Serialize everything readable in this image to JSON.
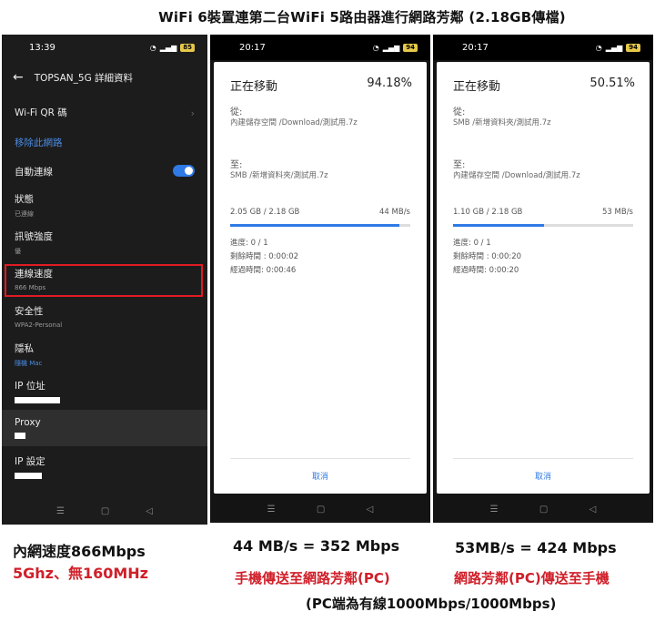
{
  "main_title": "WiFi 6裝置連第二台WiFi 5路由器進行網路芳鄰 (2.18GB傳檔)",
  "phone1": {
    "time": "13:39",
    "battery": "85",
    "header_title": "TOPSAN_5G 詳細資料",
    "rows": {
      "wifi_qr": "Wi-Fi QR 碼",
      "remove_network": "移除此網路",
      "auto_connect": "自動連線",
      "status_label": "狀態",
      "status_value": "已連線",
      "signal_label": "訊號強度",
      "signal_value": "優",
      "speed_label": "連線速度",
      "speed_value": "866 Mbps",
      "security_label": "安全性",
      "security_value": "WPA2-Personal",
      "privacy_label": "隱私",
      "privacy_value": "隨機 Mac",
      "ip_label": "IP 位址",
      "proxy_label": "Proxy",
      "ip_settings_label": "IP 設定"
    },
    "auto_connect_on": true
  },
  "phone2": {
    "time": "20:17",
    "battery": "94",
    "title": "正在移動",
    "percent": "94.18%",
    "from_label": "從:",
    "from_path": "內建儲存空間 /Download/測試用.7z",
    "to_label": "至:",
    "to_path": "SMB /新增資料夾/測試用.7z",
    "size_progress": "2.05 GB / 2.18 GB",
    "speed": "44 MB/s",
    "progress_fraction": 0.9418,
    "count": "進度: 0 / 1",
    "remaining": "剩餘時間 :  0:00:02",
    "elapsed": "經過時間: 0:00:46",
    "cancel": "取消"
  },
  "phone3": {
    "time": "20:17",
    "battery": "94",
    "title": "正在移動",
    "percent": "50.51%",
    "from_label": "從:",
    "from_path": "SMB /新增資料夾/測試用.7z",
    "to_label": "至:",
    "to_path": "內建儲存空間 /Download/測試用.7z",
    "size_progress": "1.10 GB / 2.18 GB",
    "speed": "53 MB/s",
    "progress_fraction": 0.5051,
    "count": "進度: 0 / 1",
    "remaining": "剩餘時間 :  0:00:20",
    "elapsed": "經過時間: 0:00:20",
    "cancel": "取消"
  },
  "captions": {
    "c1_line1": "內網速度866Mbps",
    "c1_line2": "5Ghz、無160MHz",
    "c2_line1": "44 MB/s =  352 Mbps",
    "c2_line2": "手機傳送至網路芳鄰(PC)",
    "c3_line1": "53MB/s = 424 Mbps",
    "c3_line2": "網路芳鄰(PC)傳送至手機",
    "c4": "(PC端為有線1000Mbps/1000Mbps)"
  },
  "colors": {
    "accent_blue": "#2f7ae5",
    "highlight_red": "#e01b24",
    "caption_red": "#d0202a"
  }
}
